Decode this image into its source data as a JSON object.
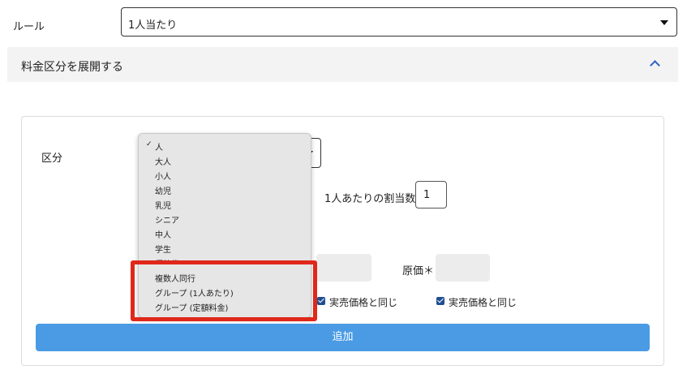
{
  "rule": {
    "label": "ルール",
    "selected": "1人当たり"
  },
  "accordion": {
    "title": "料金区分を展開する"
  },
  "form": {
    "kubun_label": "区分",
    "allocation_label": "1人あたりの割当数",
    "allocation_value": "1",
    "cost_price_label": "原価＊",
    "same_as_sale_price_1": "実売価格と同じ",
    "same_as_sale_price_2": "実売価格と同じ",
    "add_button": "追加"
  },
  "dropdown": {
    "selected_index": 0,
    "options": [
      "人",
      "大人",
      "小人",
      "幼児",
      "乳児",
      "シニア",
      "中人",
      "学生",
      "優待券",
      "複数人同行",
      "グループ (1人あたり)",
      "グループ (定額料金)"
    ],
    "check_glyph": "✓"
  },
  "colors": {
    "accent_blue": "#4a9be4",
    "highlight_red": "#e0281a",
    "checkbox_blue": "#1f4f91"
  }
}
